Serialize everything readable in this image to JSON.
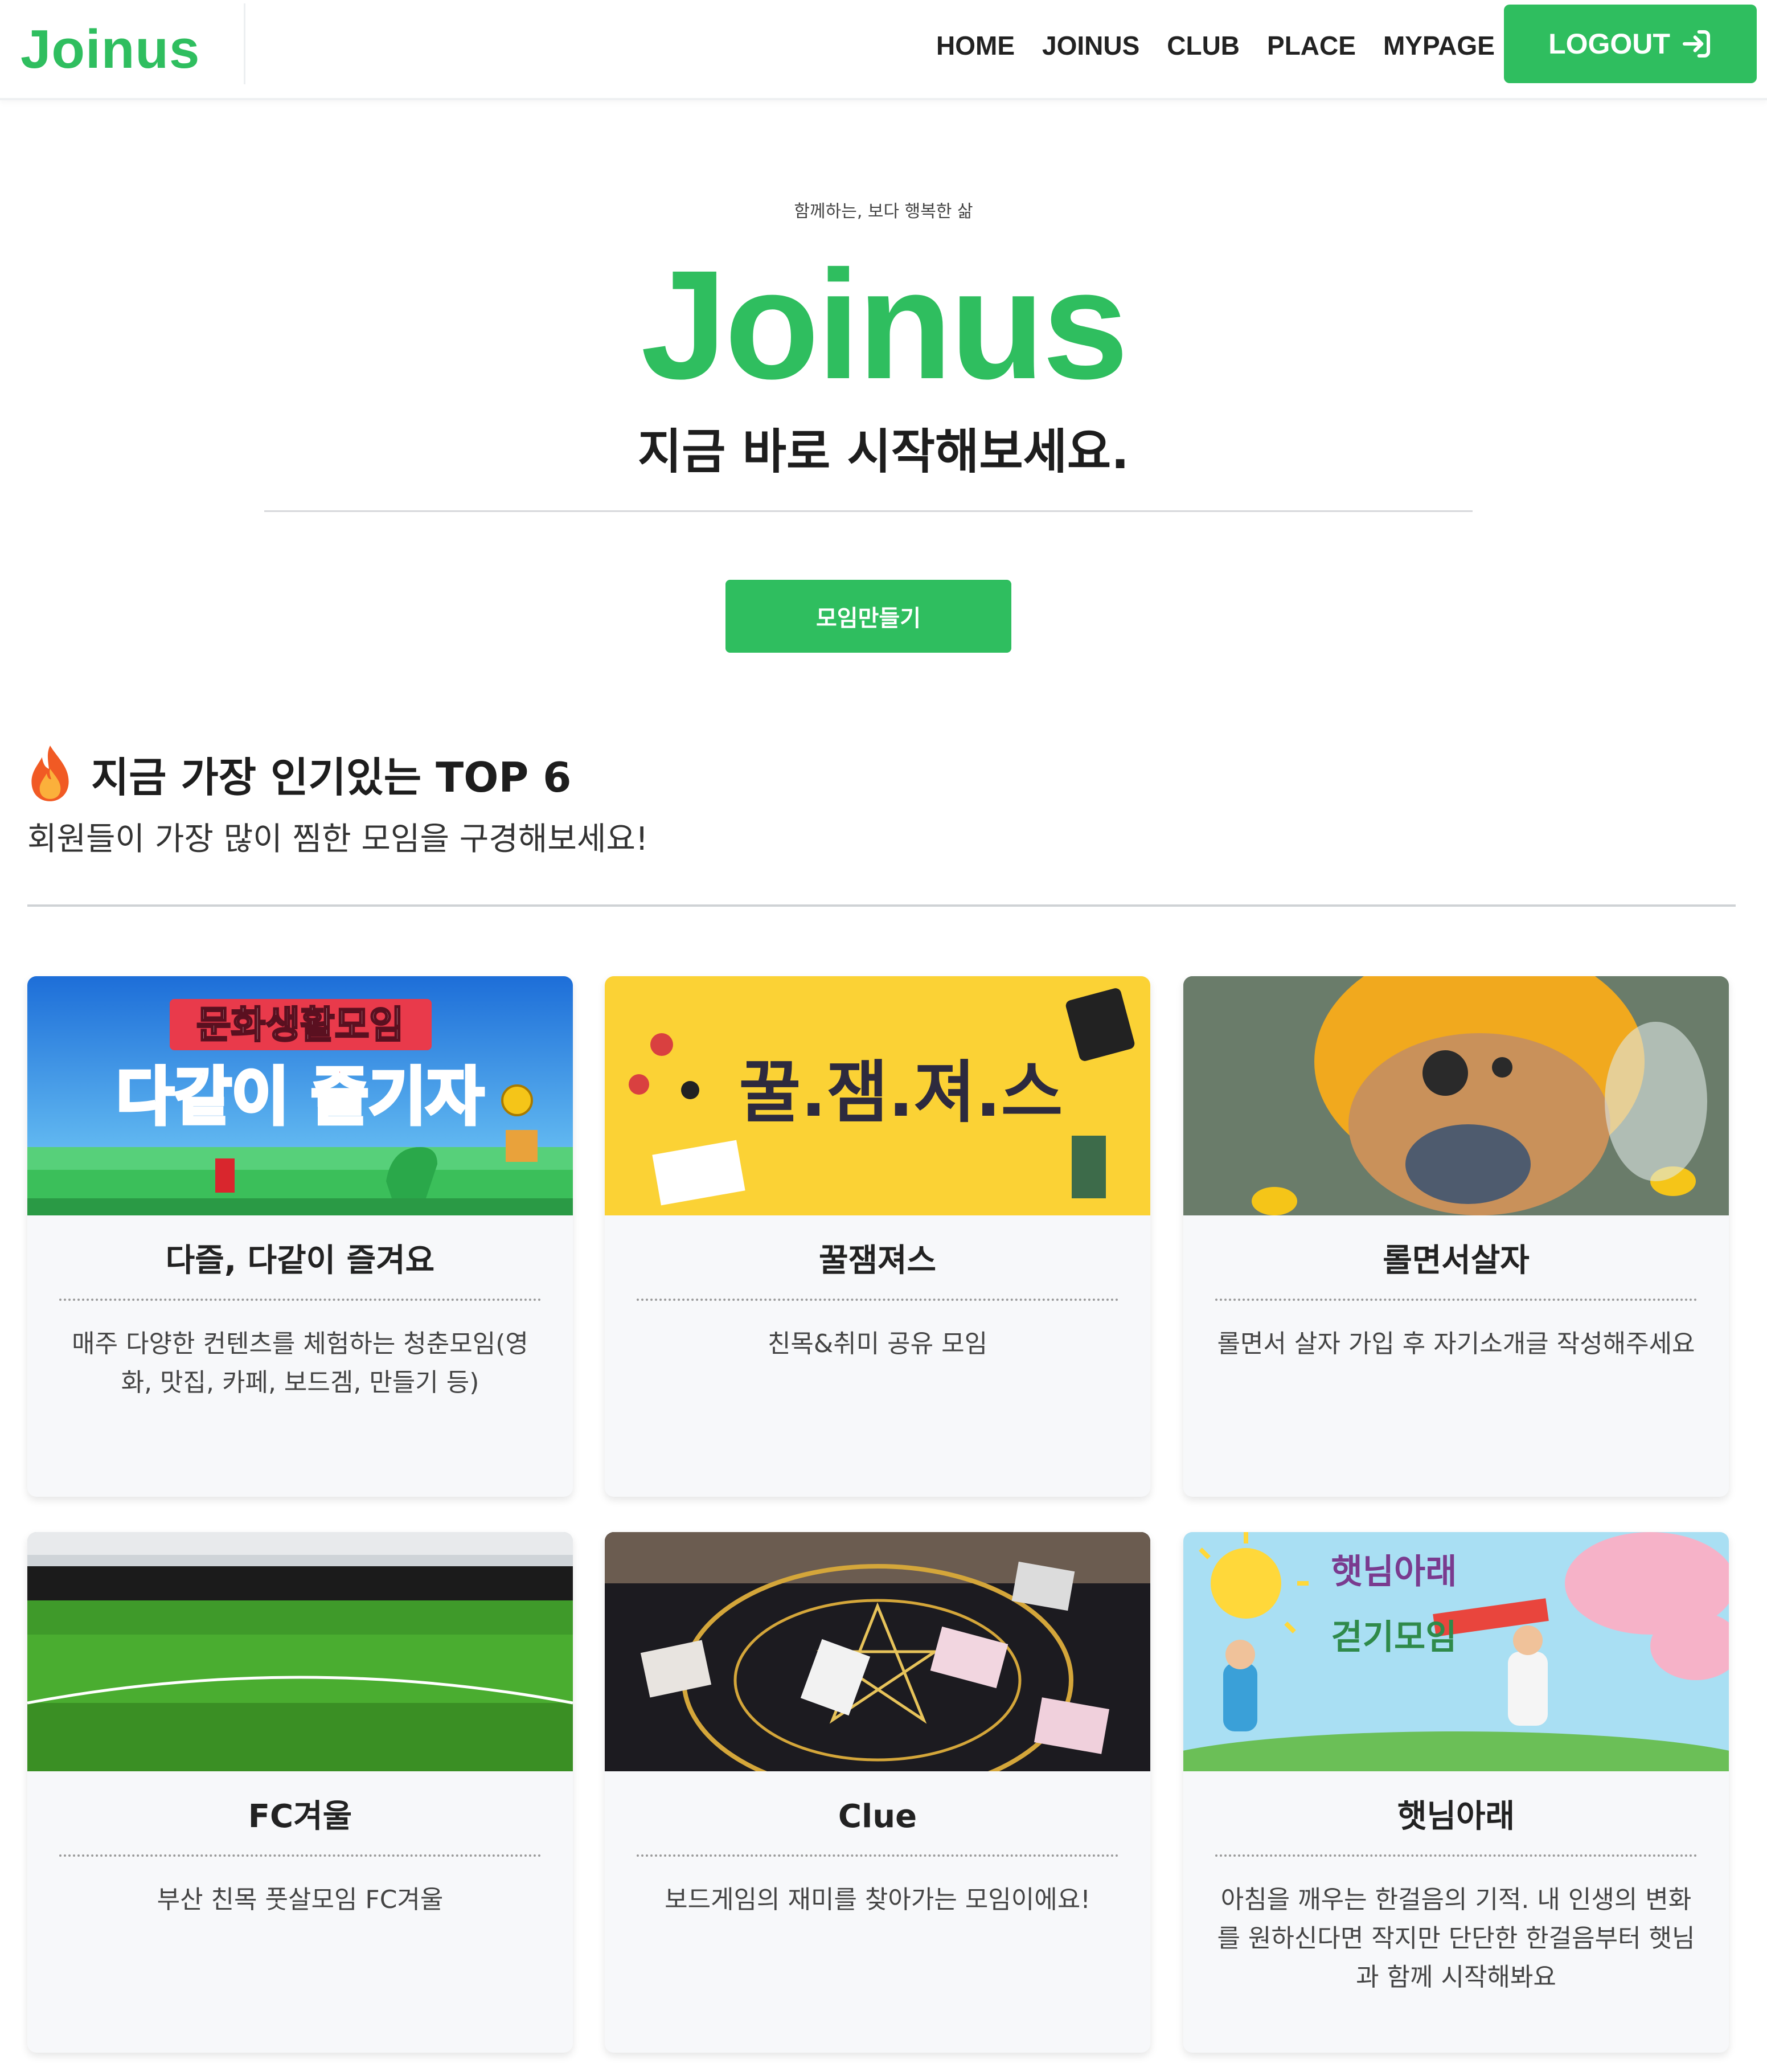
{
  "nav": {
    "brand": "Joinus",
    "links": [
      "HOME",
      "JOINUS",
      "CLUB",
      "PLACE",
      "MYPAGE"
    ],
    "logout_label": "LOGOUT"
  },
  "hero": {
    "kicker": "함께하는, 보다 행복한 삶",
    "logo": "Joinus",
    "subtitle": "지금 바로 시작해보세요.",
    "create_button": "모임만들기"
  },
  "section": {
    "title": "지금 가장 인기있는 TOP 6",
    "description": "회원들이 가장 많이 찜한 모임을 구경해보세요!"
  },
  "clubs": [
    {
      "title": "다즐, 다같이 즐겨요",
      "description": "매주 다양한 컨텐츠를 체험하는 청춘모임(영화, 맛집, 카페, 보드겜, 만들기 등)",
      "image_text": [
        "문화생활모임",
        "다같이 즐기자"
      ]
    },
    {
      "title": "꿀잼져스",
      "description": "친목&취미 공유 모임",
      "image_text": [
        "꿀.잼.져.스"
      ]
    },
    {
      "title": "롤면서살자",
      "description": "롤면서 살자 가입 후 자기소개글 작성해주세요"
    },
    {
      "title": "FC겨울",
      "description": "부산 친목 풋살모임 FC겨울"
    },
    {
      "title": "Clue",
      "description": "보드게임의 재미를 찾아가는 모임이에요!"
    },
    {
      "title": "햇님아래",
      "description": "아침을 깨우는 한걸음의 기적. 내 인생의 변화를 원하신다면 작지만 단단한 한걸음부터 햇님과 함께 시작해봐요",
      "image_text": [
        "햇님아래",
        "걷기모임"
      ]
    }
  ],
  "colors": {
    "brand_green": "#2fbe5f",
    "card_bg": "#f7f8fa"
  }
}
